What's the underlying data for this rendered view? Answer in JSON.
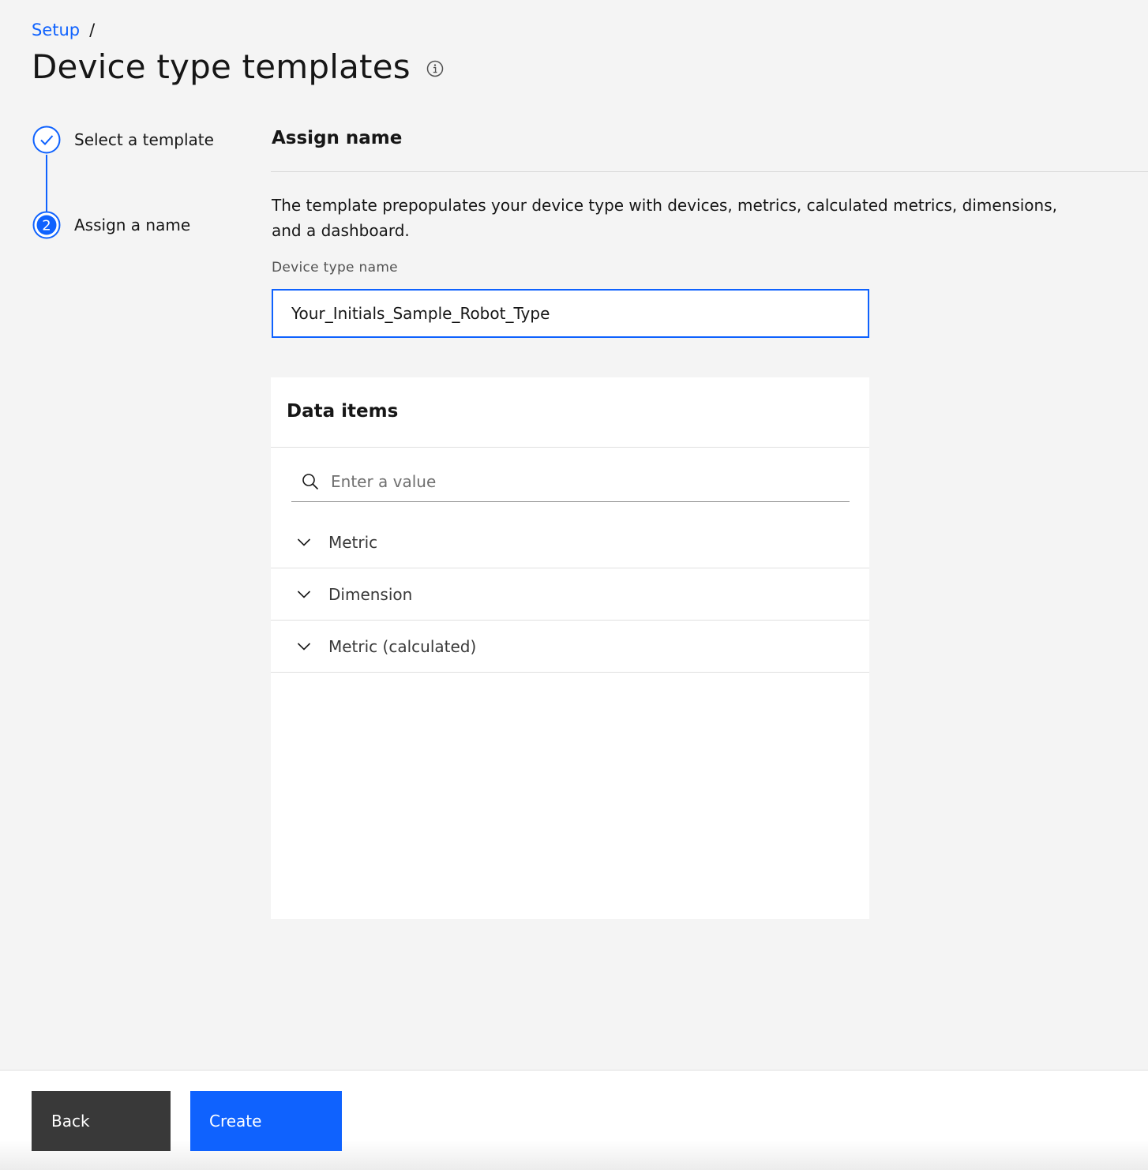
{
  "breadcrumb": {
    "link": "Setup",
    "separator": "/"
  },
  "page": {
    "title": "Device type templates",
    "info_icon": "info-icon"
  },
  "steps": [
    {
      "label": "Select a template",
      "status": "complete",
      "icon": "check-circle-icon"
    },
    {
      "label": "Assign a name",
      "status": "current",
      "number": "2",
      "icon": "step-number-icon"
    }
  ],
  "main": {
    "section_title": "Assign name",
    "description": "The template prepopulates your device type with devices, metrics, calculated metrics, dimensions, and a dashboard.",
    "field_label": "Device type name",
    "field_value": "Your_Initials_Sample_Robot_Type"
  },
  "data_items": {
    "title": "Data items",
    "search_placeholder": "Enter a value",
    "categories": [
      {
        "label": "Metric"
      },
      {
        "label": "Dimension"
      },
      {
        "label": "Metric (calculated)"
      }
    ]
  },
  "footer": {
    "back_label": "Back",
    "create_label": "Create"
  },
  "colors": {
    "accent": "#0f62fe",
    "background": "#f4f4f4",
    "back_button": "#393939"
  }
}
